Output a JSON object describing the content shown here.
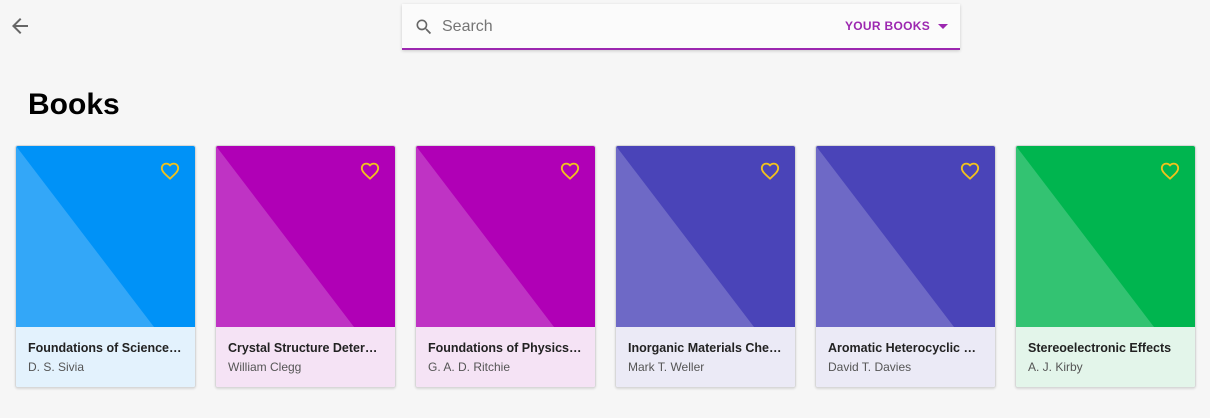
{
  "search": {
    "placeholder": "Search",
    "scope_label": "YOUR BOOKS"
  },
  "page": {
    "title": "Books"
  },
  "colors": {
    "accent": "#9c27b0",
    "heart": "#f2c21b"
  },
  "books": [
    {
      "title": "Foundations of Science Mathematics",
      "author": "D. S. Sivia",
      "cover_color": "#0092f7",
      "info_color": "#e3f2fd"
    },
    {
      "title": "Crystal Structure Determination",
      "author": "William Clegg",
      "cover_color": "#b000b6",
      "info_color": "#f5e3f5"
    },
    {
      "title": "Foundations of Physics for Chemists",
      "author": "G. A. D. Ritchie",
      "cover_color": "#b000b6",
      "info_color": "#f5e3f5"
    },
    {
      "title": "Inorganic Materials Chemistry",
      "author": "Mark T. Weller",
      "cover_color": "#4a44b8",
      "info_color": "#ebeaf6"
    },
    {
      "title": "Aromatic Heterocyclic Chemistry",
      "author": "David T. Davies",
      "cover_color": "#4a44b8",
      "info_color": "#ebeaf6"
    },
    {
      "title": "Stereoelectronic Effects",
      "author": "A. J. Kirby",
      "cover_color": "#00b54f",
      "info_color": "#e3f5ea"
    }
  ]
}
